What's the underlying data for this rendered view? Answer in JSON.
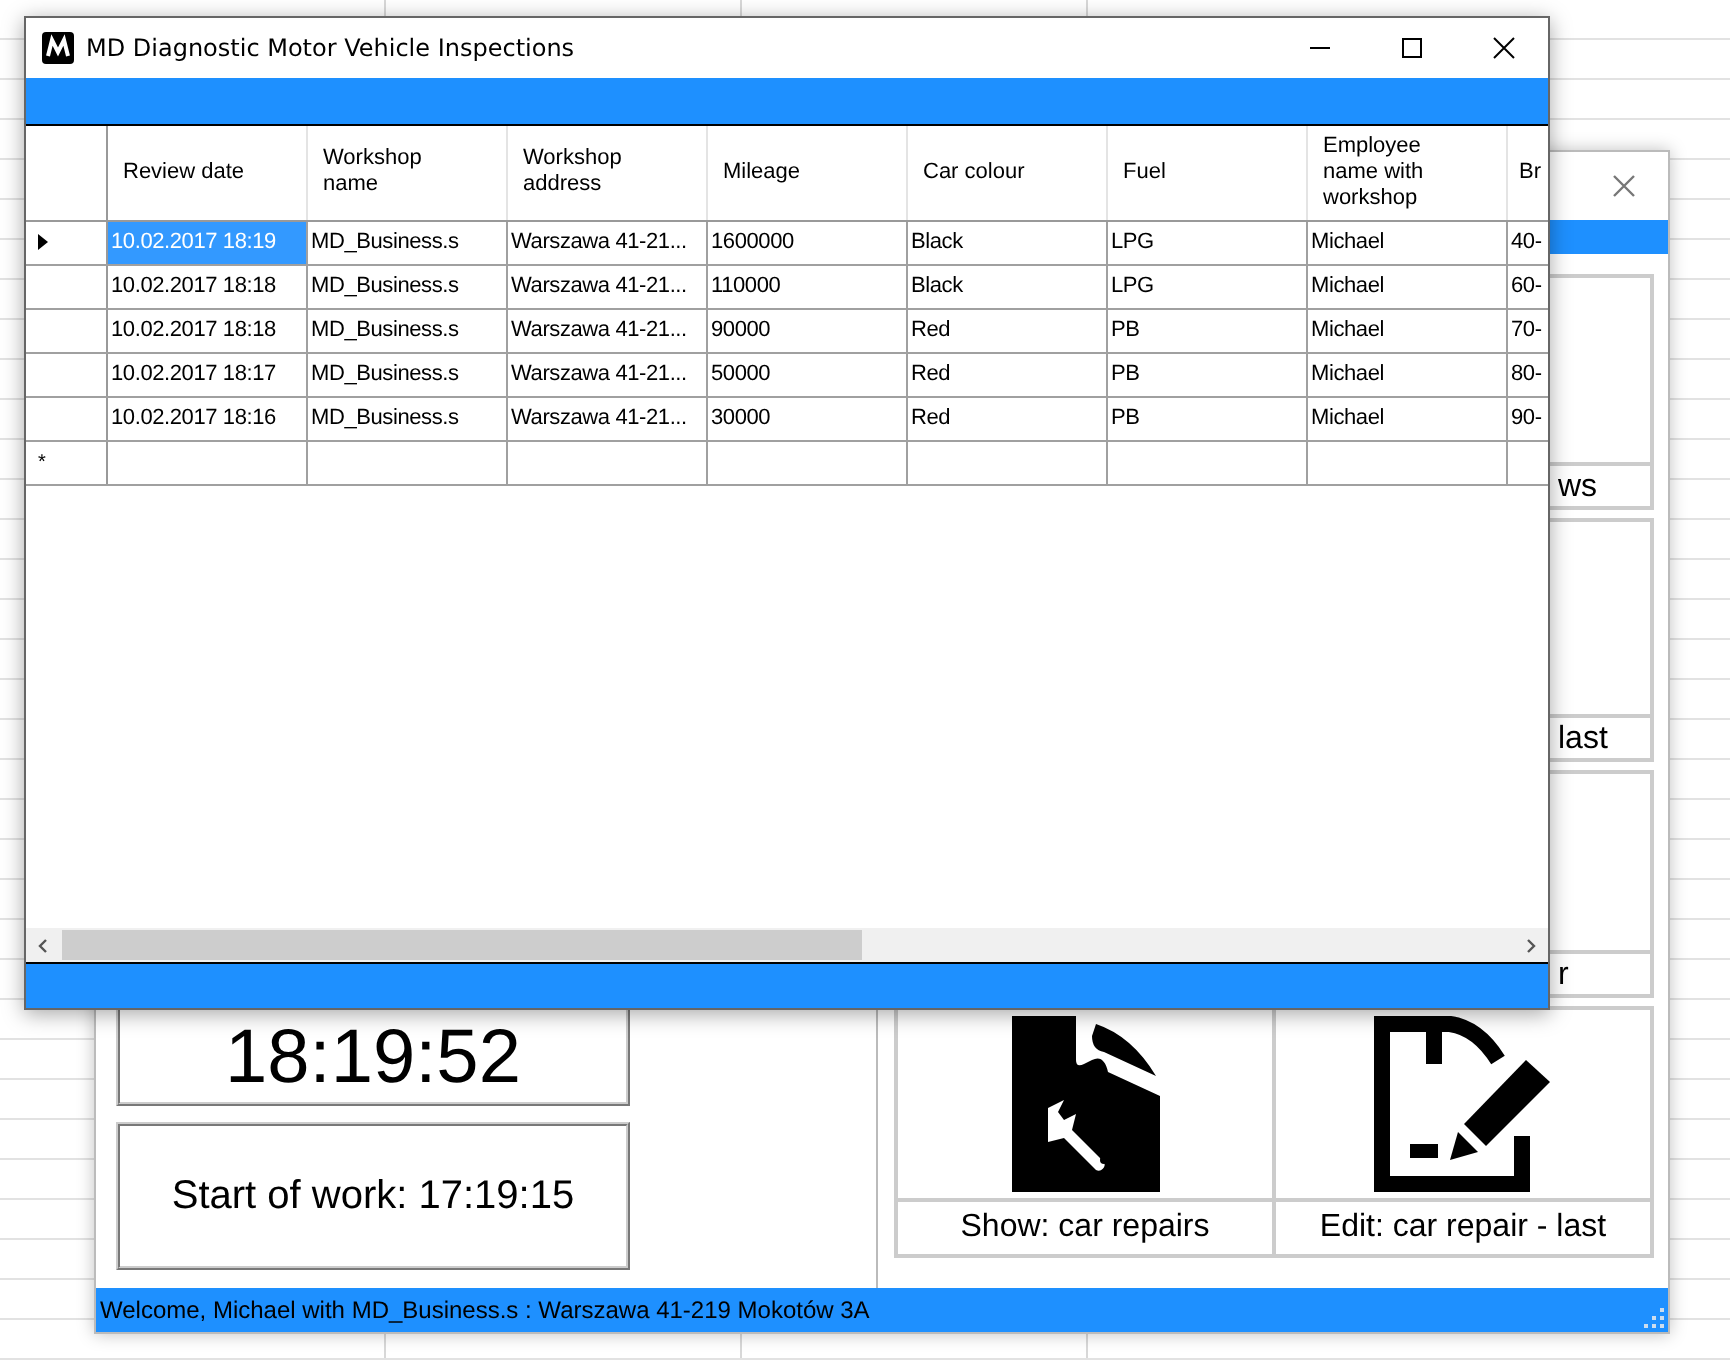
{
  "back_window": {
    "clock": "18:19:52",
    "start_of_work": "Start of work: 17:19:15",
    "tiles": [
      {
        "label": "ws",
        "kind": "text"
      },
      {
        "label": "last",
        "kind": "text"
      },
      {
        "label": "r",
        "kind": "text"
      },
      {
        "label": "Show: car repairs",
        "kind": "repairs"
      },
      {
        "label": "Edit: car repair - last",
        "kind": "edit"
      }
    ],
    "status_bar": "Welcome, Michael with MD_Business.s : Warszawa 41-219 Mokotów 3A"
  },
  "front_window": {
    "title": "MD Diagnostic Motor Vehicle Inspections",
    "columns": [
      "Review date",
      "Workshop name",
      "Workshop address",
      "Mileage",
      "Car colour",
      "Fuel",
      "Employee name with workshop",
      "Br"
    ],
    "rows": [
      {
        "selected": true,
        "cells": [
          "10.02.2017 18:19",
          "MD_Business.s",
          "Warszawa 41-21...",
          "1600000",
          "Black",
          "LPG",
          "Michael",
          "40-"
        ]
      },
      {
        "selected": false,
        "cells": [
          "10.02.2017 18:18",
          "MD_Business.s",
          "Warszawa 41-21...",
          "110000",
          "Black",
          "LPG",
          "Michael",
          "60-"
        ]
      },
      {
        "selected": false,
        "cells": [
          "10.02.2017 18:18",
          "MD_Business.s",
          "Warszawa 41-21...",
          "90000",
          "Red",
          "PB",
          "Michael",
          "70-"
        ]
      },
      {
        "selected": false,
        "cells": [
          "10.02.2017 18:17",
          "MD_Business.s",
          "Warszawa 41-21...",
          "50000",
          "Red",
          "PB",
          "Michael",
          "80-"
        ]
      },
      {
        "selected": false,
        "cells": [
          "10.02.2017 18:16",
          "MD_Business.s",
          "Warszawa 41-21...",
          "30000",
          "Red",
          "PB",
          "Michael",
          "90-"
        ]
      }
    ],
    "new_row_marker": "*"
  }
}
